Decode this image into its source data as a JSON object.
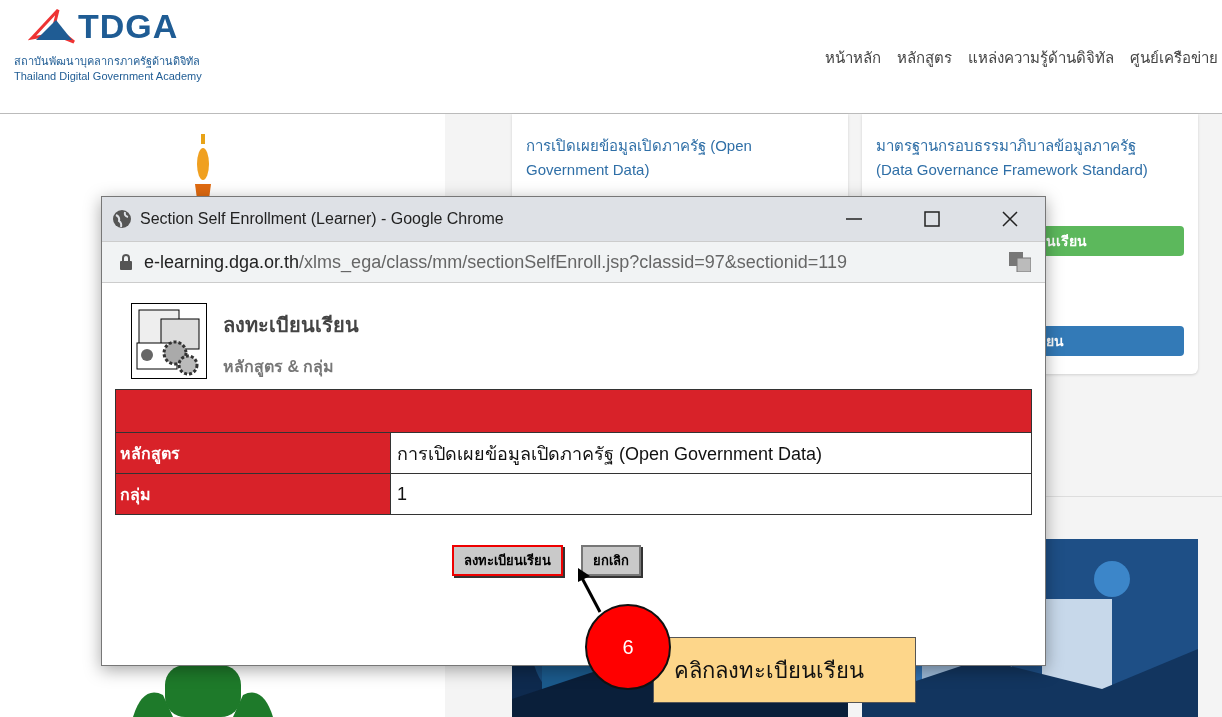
{
  "site": {
    "logo_text": "TDGA",
    "logo_subtitle_th": "สถาบันพัฒนาบุคลากรภาครัฐด้านดิจิทัล",
    "logo_subtitle_en": "Thailand Digital Government Academy",
    "nav": [
      "หน้าหลัก",
      "หลักสูตร",
      "แหล่งความรู้ด้านดิจิทัล",
      "ศูนย์เครือข่าย"
    ]
  },
  "courses": [
    {
      "title": "การเปิดเผยข้อมูลเปิดภาครัฐ (Open Government Data)"
    },
    {
      "title": "มาตรฐานกรอบธรรมาภิบาลข้อมูลภาครัฐ (Data Governance Framework Standard)",
      "buttons": [
        {
          "label": "นเรียน",
          "kind": "green"
        },
        {
          "label": "ยน",
          "kind": "blue"
        }
      ]
    }
  ],
  "popup": {
    "title": "Section Self Enrollment (Learner) - Google Chrome",
    "url_host": "e-learning.dga.or.th",
    "url_path": "/xlms_ega/class/mm/sectionSelfEnroll.jsp?classid=97&sectionid=119",
    "heading": "ลงทะเบียนเรียน",
    "subheading": "หลักสูตร & กลุ่ม",
    "rows": [
      {
        "label": "หลักสูตร",
        "value": "การเปิดเผยข้อมูลเปิดภาครัฐ (Open Government Data)"
      },
      {
        "label": "กลุ่ม",
        "value": "1"
      }
    ],
    "buttons": [
      {
        "label": "ลงทะเบียนเรียน",
        "highlighted": true
      },
      {
        "label": "ยกเลิก",
        "highlighted": false
      }
    ]
  },
  "callout": {
    "number": "6",
    "text": "คลิกลงทะเบียนเรียน"
  }
}
